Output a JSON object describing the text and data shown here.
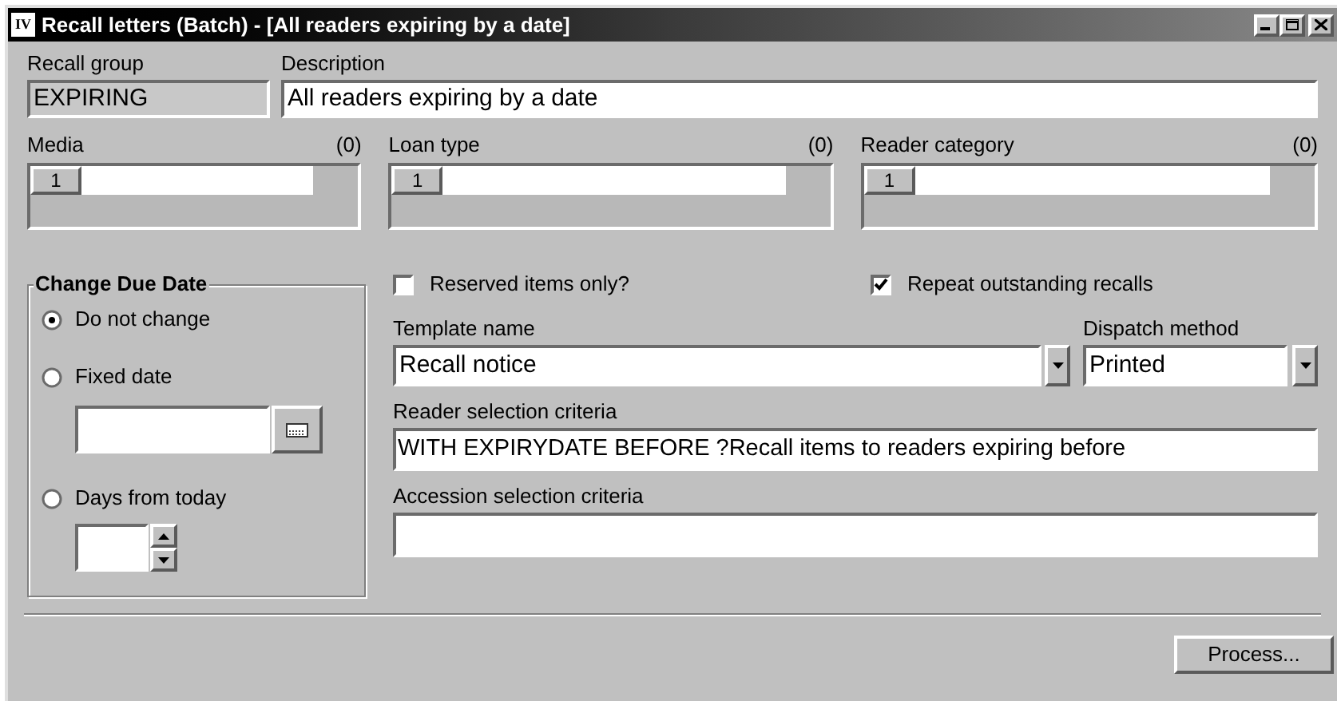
{
  "window": {
    "title": "Recall letters (Batch) - [All readers expiring by a date]",
    "app_badge": "IV"
  },
  "recall_group": {
    "label": "Recall group",
    "value": "EXPIRING"
  },
  "description": {
    "label": "Description",
    "value": "All readers expiring by a date"
  },
  "lists": [
    {
      "label": "Media",
      "count": "(0)",
      "row_number": "1"
    },
    {
      "label": "Loan type",
      "count": "(0)",
      "row_number": "1"
    },
    {
      "label": "Reader category",
      "count": "(0)",
      "row_number": "1"
    }
  ],
  "change_due_date": {
    "title": "Change Due Date",
    "options": [
      {
        "label": "Do not change",
        "selected": true,
        "kind": "plain"
      },
      {
        "label": "Fixed date",
        "selected": false,
        "kind": "date"
      },
      {
        "label": "Days from today",
        "selected": false,
        "kind": "spin"
      }
    ]
  },
  "checkboxes": [
    {
      "label": "Reserved items only?",
      "checked": false
    },
    {
      "label": "Repeat outstanding recalls",
      "checked": true
    }
  ],
  "template": {
    "label": "Template name",
    "value": "Recall notice"
  },
  "dispatch": {
    "label": "Dispatch method",
    "value": "Printed"
  },
  "reader_criteria": {
    "label": "Reader selection criteria",
    "value": "WITH EXPIRYDATE BEFORE ?Recall items to readers expiring before"
  },
  "accession_criteria": {
    "label": "Accession selection criteria"
  },
  "process_button": "Process..."
}
